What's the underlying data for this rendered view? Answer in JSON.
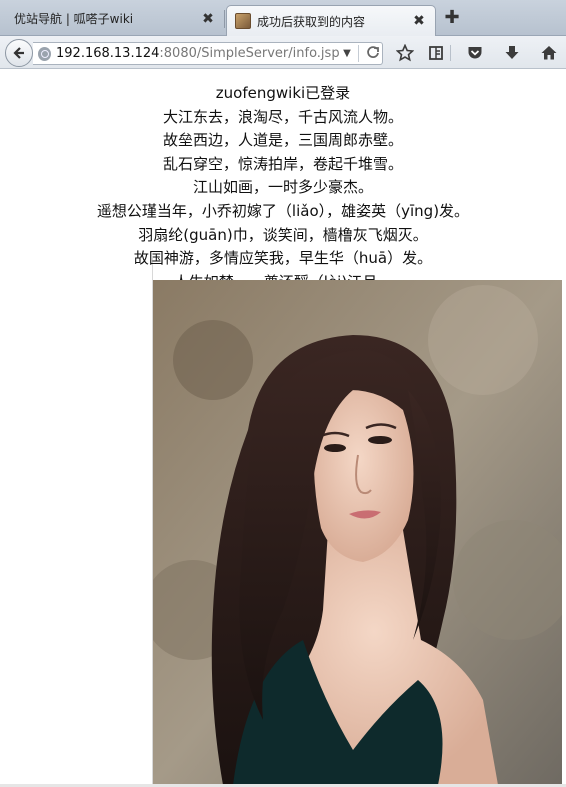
{
  "tabs": [
    {
      "label": "优站导航 | 呱嗒子wiki",
      "active": false
    },
    {
      "label": "成功后获取到的内容",
      "active": true
    }
  ],
  "tab_close_glyph": "✖",
  "new_tab_glyph": "✚",
  "url": {
    "host": "192.168.13.124",
    "rest": ":8080/SimpleServer/info.jsp"
  },
  "icons": {
    "back": "back-arrow-icon",
    "globe": "globe-icon",
    "dropdown": "dropdown-arrow-icon",
    "reload": "reload-icon",
    "bookmark": "star-icon",
    "reading_list": "reading-list-icon",
    "pocket": "pocket-icon",
    "download": "download-icon",
    "home": "home-icon"
  },
  "content": {
    "status": "zuofengwiki已登录",
    "poem_lines": [
      "大江东去，浪淘尽，千古风流人物。",
      "故垒西边，人道是，三国周郎赤壁。",
      "乱石穿空，惊涛拍岸，卷起千堆雪。",
      "江山如画，一时多少豪杰。",
      "遥想公瑾当年，小乔初嫁了（liǎo），雄姿英（yīng)发。",
      "羽扇纶(guān)巾，谈笑间，樯橹灰飞烟灭。",
      "故国神游，多情应笑我，早生华（huā）发。",
      "人生如梦，一尊还酹（lèi)江月。"
    ]
  }
}
